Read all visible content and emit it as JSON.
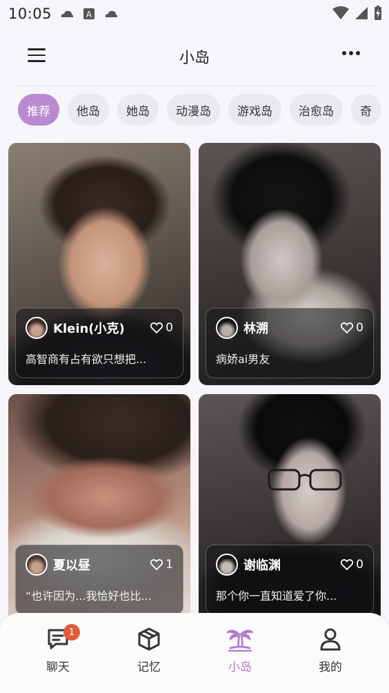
{
  "status": {
    "time": "10:05"
  },
  "header": {
    "title": "小岛"
  },
  "tabs": [
    {
      "label": "推荐",
      "active": true
    },
    {
      "label": "他岛"
    },
    {
      "label": "她岛"
    },
    {
      "label": "动漫岛"
    },
    {
      "label": "游戏岛"
    },
    {
      "label": "治愈岛"
    },
    {
      "label": "奇"
    }
  ],
  "cards": [
    {
      "name": "Klein(小克)",
      "likes": "0",
      "desc": "高智商有占有欲只想把..."
    },
    {
      "name": "林溯",
      "likes": "0",
      "desc": "病娇ai男友"
    },
    {
      "name": "夏以昼",
      "likes": "1",
      "desc": "“也许因为...我恰好也比..."
    },
    {
      "name": "谢临渊",
      "likes": "0",
      "desc": "那个你一直知道爱了你..."
    }
  ],
  "nav": {
    "items": [
      {
        "label": "聊天",
        "icon": "chat-icon",
        "badge": "1"
      },
      {
        "label": "记忆",
        "icon": "cube-icon"
      },
      {
        "label": "小岛",
        "icon": "palm-island-icon",
        "active": true
      },
      {
        "label": "我的",
        "icon": "user-icon"
      }
    ]
  },
  "colors": {
    "accent": "#b98ad0",
    "badge": "#e25b3a",
    "background": "#f6f5f9"
  }
}
